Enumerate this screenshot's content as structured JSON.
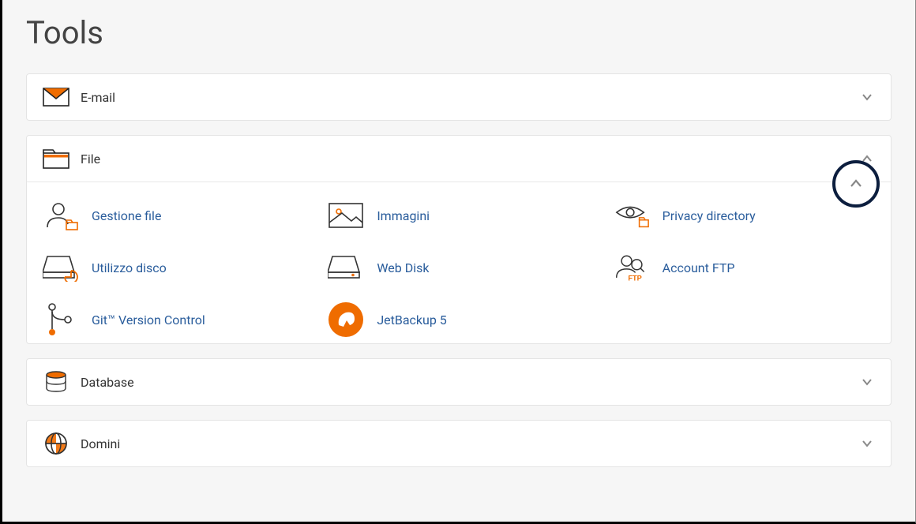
{
  "page_title": "Tools",
  "panels": {
    "email": {
      "label": "E-mail"
    },
    "file": {
      "label": "File",
      "items": [
        {
          "label": "Gestione file"
        },
        {
          "label": "Immagini"
        },
        {
          "label": "Privacy directory"
        },
        {
          "label": "Utilizzo disco"
        },
        {
          "label": "Web Disk"
        },
        {
          "label": "Account FTP"
        },
        {
          "label": "Git™ Version Control"
        },
        {
          "label": "JetBackup 5"
        }
      ]
    },
    "database": {
      "label": "Database"
    },
    "domains": {
      "label": "Domini"
    }
  },
  "colors": {
    "accent": "#ef6c00",
    "link": "#2a5d9c",
    "border_dark": "#0c1e3e"
  }
}
